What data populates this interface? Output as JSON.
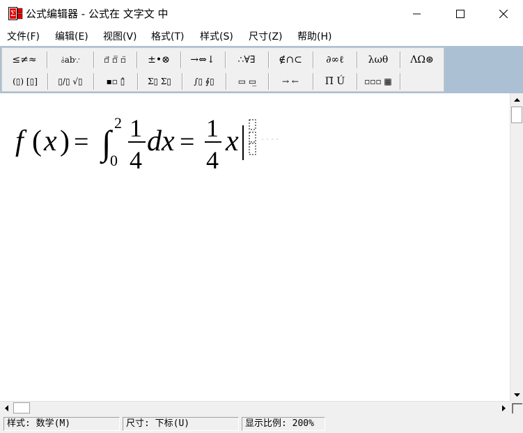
{
  "window": {
    "title": "公式编辑器 - 公式在 文字文 中"
  },
  "menu": [
    {
      "label": "文件(F)"
    },
    {
      "label": "编辑(E)"
    },
    {
      "label": "视图(V)"
    },
    {
      "label": "格式(T)"
    },
    {
      "label": "样式(S)"
    },
    {
      "label": "尺寸(Z)"
    },
    {
      "label": "帮助(H)"
    }
  ],
  "toolbar": {
    "row1": [
      {
        "label": "≤≠≈",
        "icon": "relations-palette-icon"
      },
      {
        "label": "⫰ab∵",
        "icon": "spaces-ellipses-palette-icon"
      },
      {
        "label": "▫⃗ ▫̿ ▫̈",
        "icon": "embellishments-palette-icon"
      },
      {
        "label": "±•⊗",
        "icon": "operators-palette-icon"
      },
      {
        "label": "→⇔↓",
        "icon": "arrows-palette-icon"
      },
      {
        "label": "∴∀∃",
        "icon": "logic-palette-icon"
      },
      {
        "label": "∉∩⊂",
        "icon": "set-theory-palette-icon"
      },
      {
        "label": "∂∞ℓ",
        "icon": "misc-symbols-palette-icon"
      },
      {
        "label": "λωθ",
        "icon": "greek-lowercase-palette-icon"
      },
      {
        "label": "ΛΩ⊛",
        "icon": "greek-uppercase-palette-icon"
      }
    ],
    "row2": [
      {
        "label": "(▯) [▯]",
        "icon": "fences-palette-icon"
      },
      {
        "label": "▯/▯ √▯",
        "icon": "fractions-radicals-palette-icon"
      },
      {
        "label": "▪▫ ▯̂",
        "icon": "subscript-superscript-palette-icon"
      },
      {
        "label": "Σ▯ Σ▯",
        "icon": "summation-palette-icon"
      },
      {
        "label": "∫▯ ∮▯",
        "icon": "integrals-palette-icon"
      },
      {
        "label": "▭ ▭̲",
        "icon": "underbar-overbar-palette-icon"
      },
      {
        "label": "→ ←",
        "icon": "labeled-arrows-palette-icon"
      },
      {
        "label": "Π̈ Ú",
        "icon": "products-set-theory-palette-icon"
      },
      {
        "label": "▫▫▫ ▦",
        "icon": "matrices-palette-icon"
      }
    ]
  },
  "formula": {
    "lhs_func": "f",
    "lhs_open": "(",
    "lhs_var": "x",
    "lhs_close": ")",
    "eq1": "=",
    "integral": "∫",
    "upper": "2",
    "lower": "0",
    "frac1_num": "1",
    "frac1_den": "4",
    "differential": "dx",
    "eq2": "=",
    "frac2_num": "1",
    "frac2_den": "4",
    "rhs_var": "x"
  },
  "status": {
    "style": "样式: 数学(M)",
    "size": "尺寸: 下标(U)",
    "zoom": "显示比例: 200%"
  }
}
